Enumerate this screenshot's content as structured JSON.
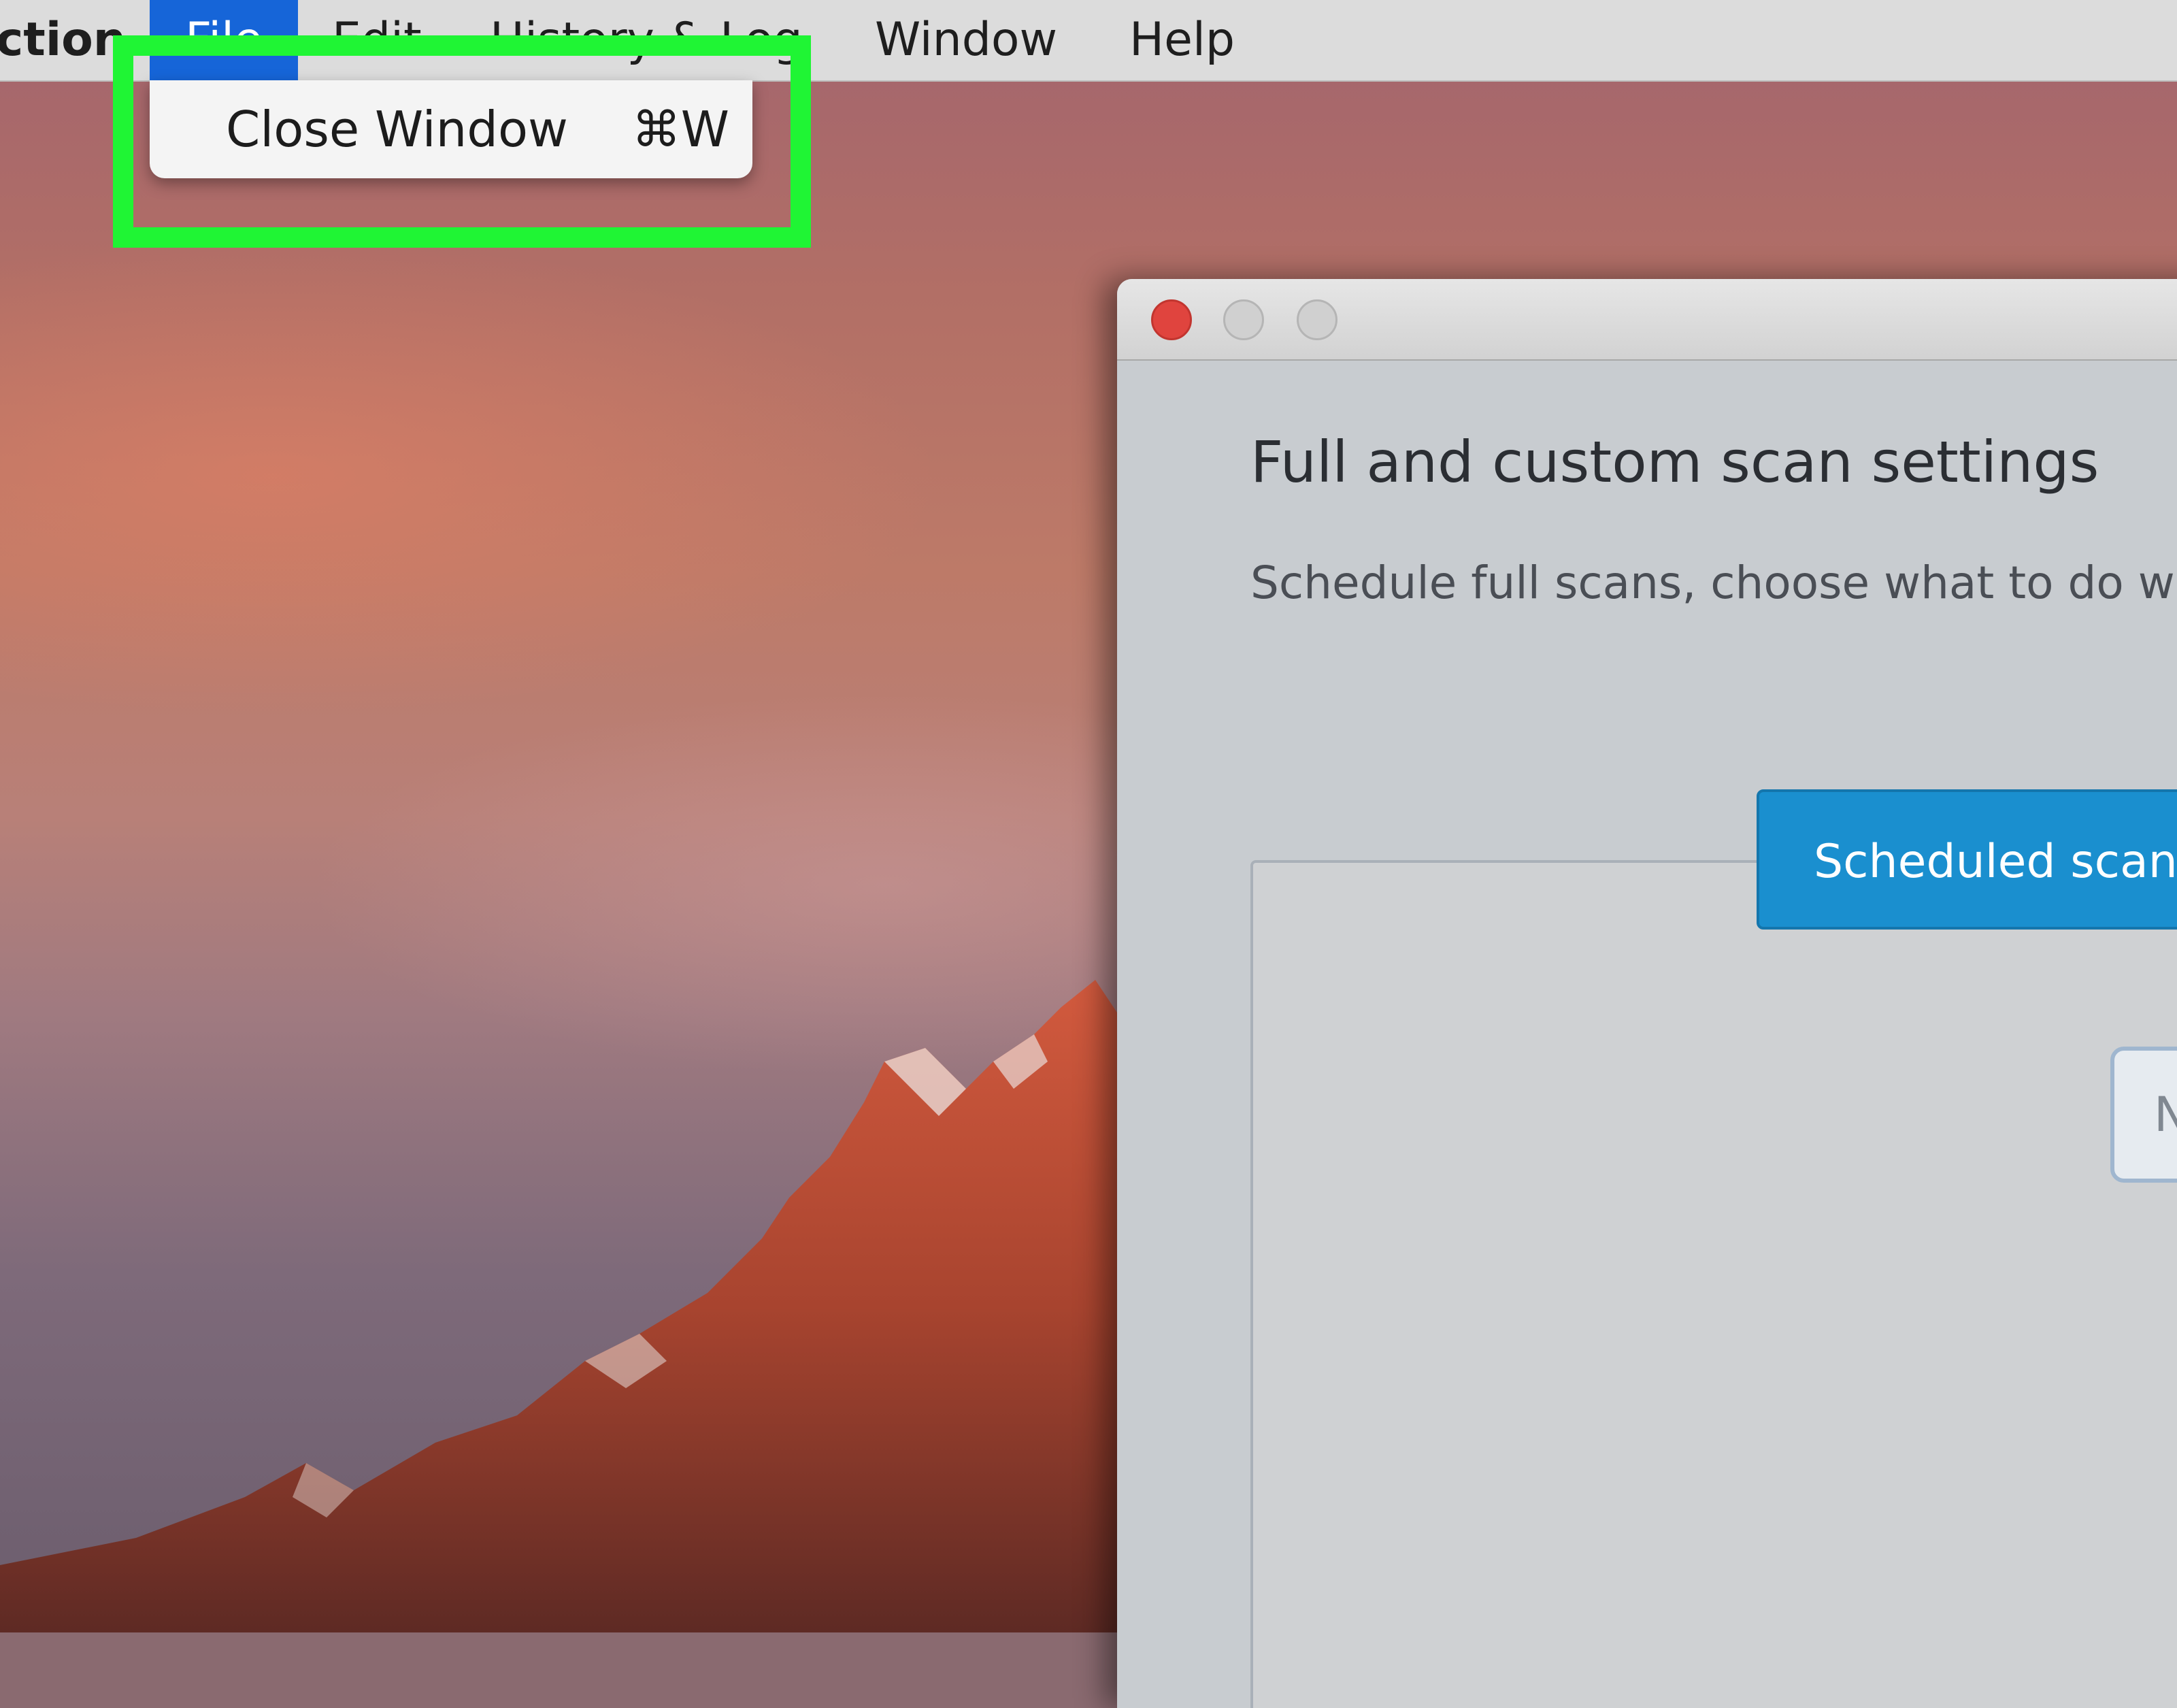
{
  "menubar": {
    "app_name": "ction",
    "items": [
      "File",
      "Edit",
      "History & Log",
      "Window",
      "Help"
    ],
    "active_item": "File"
  },
  "dropdown": {
    "item_label": "Close Window",
    "item_shortcut": "⌘W"
  },
  "window": {
    "title": "Full and custom scan settings",
    "subtitle": "Schedule full scans, choose what to do w",
    "tab_label": "Scheduled scan",
    "field_text": "N"
  },
  "colors": {
    "highlight_box": "#1ff534",
    "menu_active": "#1665d8",
    "tab_blue": "#1a8fcf",
    "close_button": "#e0443e"
  },
  "icons": [
    "close-window-icon",
    "minimize-window-icon",
    "zoom-window-icon",
    "command-key-icon"
  ]
}
